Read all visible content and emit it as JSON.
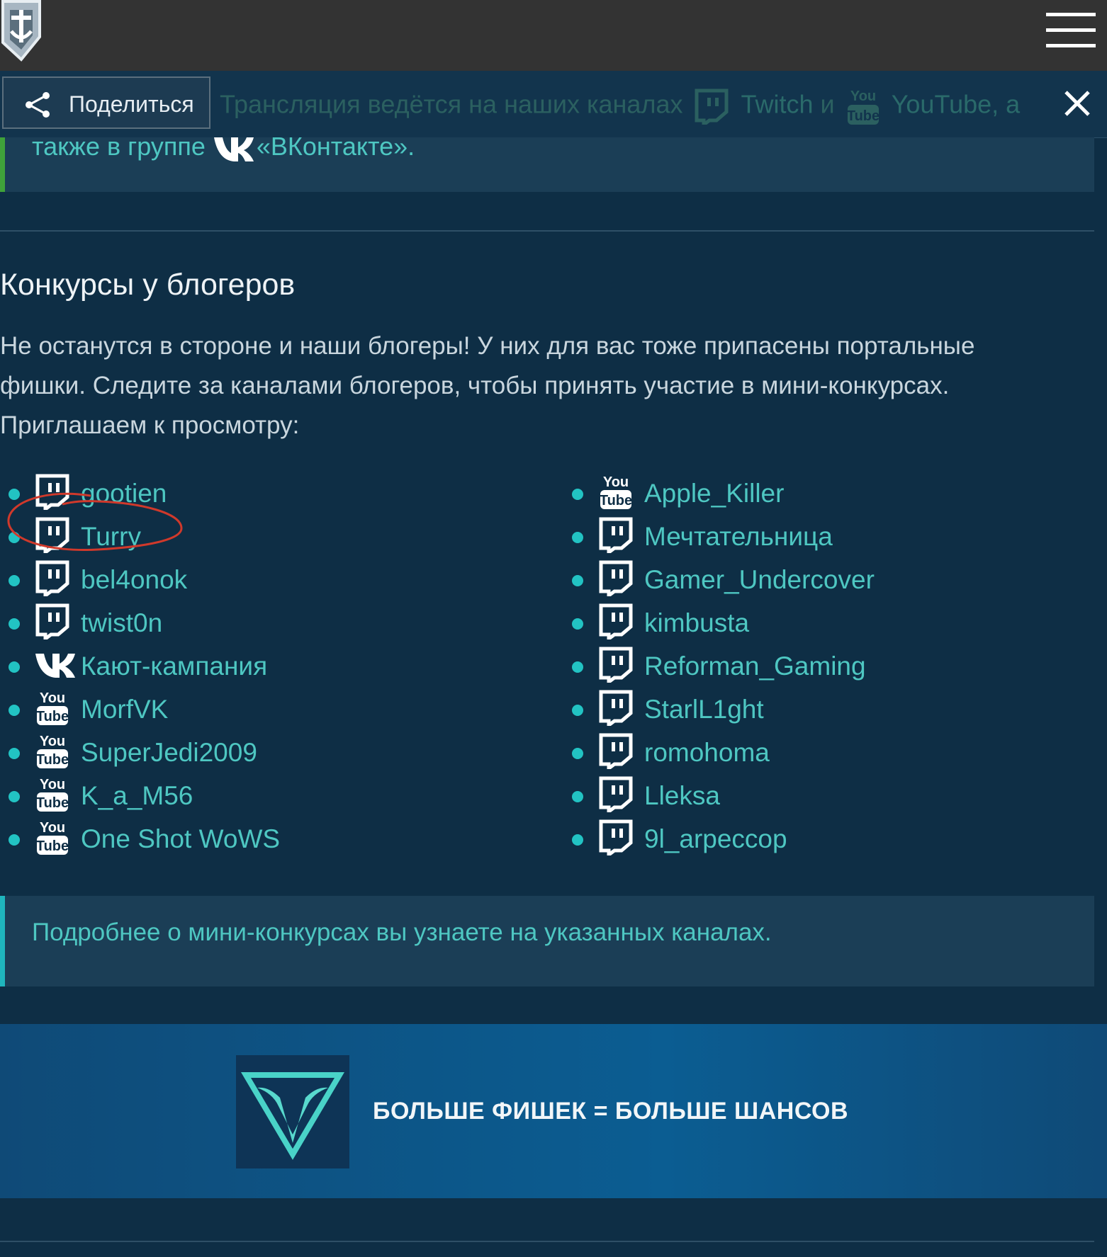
{
  "header": {
    "logo_icon": "anchor-shield-logo-icon",
    "menu_icon": "hamburger-menu-icon"
  },
  "share_bar": {
    "share_label": "Поделиться",
    "share_icon": "share-icon",
    "announcement_text": "Трансляция ведётся на наших каналах",
    "twitch_label": "Twitch",
    "conj": "и",
    "youtube_label": "YouTube, а",
    "close_icon": "close-icon"
  },
  "top_callout": {
    "prefix": "также в группе",
    "vk_label": "«ВКонтакте»",
    "suffix": "."
  },
  "section": {
    "title": "Конкурсы у блогеров",
    "paragraph_lines": [
      "Не останутся в стороне и наши блогеры! У них для вас тоже припасены портальные",
      "фишки. Следите за каналами блогеров, чтобы принять участие в мини-конкурсах.",
      "Приглашаем к просмотру:"
    ]
  },
  "bloggers_left": [
    {
      "platform": "twitch",
      "name": "gootien"
    },
    {
      "platform": "twitch",
      "name": "Turry"
    },
    {
      "platform": "twitch",
      "name": "bel4onok"
    },
    {
      "platform": "twitch",
      "name": "twist0n"
    },
    {
      "platform": "vk",
      "name": "Кают-кампания"
    },
    {
      "platform": "youtube",
      "name": "MorfVK"
    },
    {
      "platform": "youtube",
      "name": "SuperJedi2009"
    },
    {
      "platform": "youtube",
      "name": "K_a_M56"
    },
    {
      "platform": "youtube",
      "name": "One Shot WoWS"
    }
  ],
  "bloggers_right": [
    {
      "platform": "youtube",
      "name": "Apple_Killer"
    },
    {
      "platform": "twitch",
      "name": "Мечтательница"
    },
    {
      "platform": "twitch",
      "name": "Gamer_Undercover"
    },
    {
      "platform": "twitch",
      "name": "kimbusta"
    },
    {
      "platform": "twitch",
      "name": "Reforman_Gaming"
    },
    {
      "platform": "twitch",
      "name": "StarlL1ght"
    },
    {
      "platform": "twitch",
      "name": "romohoma"
    },
    {
      "platform": "twitch",
      "name": "Lleksa"
    },
    {
      "platform": "twitch",
      "name": "9l_arpeccop"
    }
  ],
  "bottom_callout": {
    "text": "Подробнее о мини-конкурсах вы узнаете на указанных каналах."
  },
  "banner": {
    "emblem_icon": "triangle-whale-tail-emblem-icon",
    "text": "БОЛЬШЕ ФИШЕК = БОЛЬШЕ ШАНСОВ"
  },
  "colors": {
    "background": "#0e2e45",
    "link": "#4ec7c2",
    "bullet": "#22c3c3",
    "topbar": "#333333",
    "annotation": "#d0392b"
  }
}
